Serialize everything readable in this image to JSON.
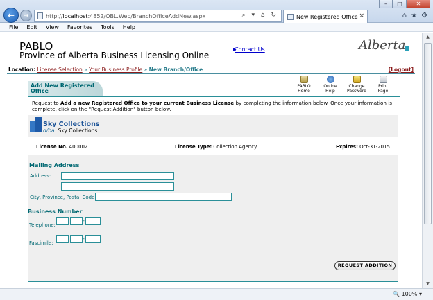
{
  "browser": {
    "url_prefix": "http://",
    "url_host": "localhost",
    "url_rest": ":4852/OBL.Web/BranchOfficeAddNew.aspx",
    "tab_title": "New Registered Office",
    "address_tools": "⌕ ▾ ⌂ ↻",
    "window_controls": {
      "min": "–",
      "max": "□",
      "close": "✕"
    },
    "menu": [
      "File",
      "Edit",
      "View",
      "Favorites",
      "Tools",
      "Help"
    ],
    "zoom": "100%",
    "icons": [
      "home-icon",
      "star-icon",
      "gear-icon"
    ]
  },
  "site": {
    "title": "PABLO",
    "subtitle": "Province of Alberta Business Licensing Online",
    "contact_link": "Contact Us",
    "logo_text": "Alberta"
  },
  "location": {
    "label": "Location:",
    "crumbs": [
      "License Selection",
      "Your Business Profile"
    ],
    "separator": "»",
    "current": "New Branch/Office",
    "logout": "[Logout]"
  },
  "panel": {
    "title_line1": "Add New Registered",
    "title_line2": "Office",
    "tools": [
      {
        "line1": "PABLO",
        "line2": "Home"
      },
      {
        "line1": "Online",
        "line2": "Help"
      },
      {
        "line1": "Change",
        "line2": "Password"
      },
      {
        "line1": "Print",
        "line2": "Page"
      }
    ],
    "intro_before": "Request to ",
    "intro_bold": "Add a new Registered Office to your current Business License",
    "intro_after": " by completing the information below. Once your information is complete, click on the \"Request Addition\" button below."
  },
  "company": {
    "name": "Sky Collections",
    "dba_label": "d/ba:",
    "dba_value": "Sky Collections"
  },
  "license": {
    "no_label": "License No.",
    "no_value": "400002",
    "type_label": "License Type:",
    "type_value": "Collection Agency",
    "exp_label": "Expires:",
    "exp_value": "Oct-31-2015"
  },
  "form": {
    "mailing_title": "Mailing Address",
    "address_label": "Address:",
    "city_label": "City, Province, Postal Code:",
    "business_title": "Business Number",
    "telephone_label": "Telephone:",
    "fax_label": "Fascimile:",
    "dash": "-",
    "submit_label": "REQUEST ADDITION"
  }
}
